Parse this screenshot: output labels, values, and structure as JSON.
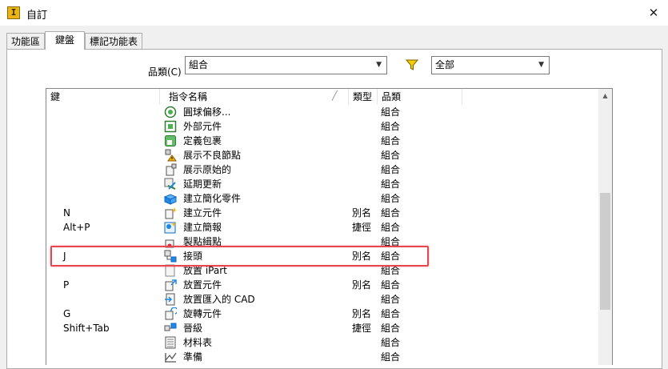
{
  "window": {
    "title": "自訂",
    "app_icon_letter": "I",
    "close_glyph": "✕"
  },
  "tabs": [
    {
      "label": "功能區",
      "active": false
    },
    {
      "label": "鍵盤",
      "active": true
    },
    {
      "label": "標記功能表",
      "active": false
    }
  ],
  "filter": {
    "category_label": "品類(C)",
    "category_value": "組合",
    "scope_value": "全部",
    "filter_icon": "funnel-icon",
    "filter_color": "#f2d000"
  },
  "table": {
    "headers": {
      "key": "鍵",
      "command": "指令名稱",
      "type": "類型",
      "category": "品類"
    },
    "rows": [
      {
        "key": "",
        "icon": "orbit-offset-icon",
        "name": "圓球偏移...",
        "type": "",
        "category": "組合"
      },
      {
        "key": "",
        "icon": "external-component-icon",
        "name": "外部元件",
        "type": "",
        "category": "組合"
      },
      {
        "key": "",
        "icon": "define-envelope-icon",
        "name": "定義包裹",
        "type": "",
        "category": "組合"
      },
      {
        "key": "",
        "icon": "show-sick-nodes-icon",
        "name": "展示不良節點",
        "type": "",
        "category": "組合"
      },
      {
        "key": "",
        "icon": "show-original-icon",
        "name": "展示原始的",
        "type": "",
        "category": "組合"
      },
      {
        "key": "",
        "icon": "defer-update-icon",
        "name": "延期更新",
        "type": "",
        "category": "組合"
      },
      {
        "key": "",
        "icon": "create-simplified-part-icon",
        "name": "建立簡化零件",
        "type": "",
        "category": "組合"
      },
      {
        "key": "N",
        "icon": "create-component-icon",
        "name": "建立元件",
        "type": "別名",
        "category": "組合"
      },
      {
        "key": "Alt+P",
        "icon": "create-profile-icon",
        "name": "建立簡報",
        "type": "捷徑",
        "category": "組合"
      },
      {
        "key": "",
        "icon": "make-points-icon",
        "name": "製點緝點",
        "type": "",
        "category": "組合"
      },
      {
        "key": "J",
        "icon": "joint-icon",
        "name": "接頭",
        "type": "別名",
        "category": "組合"
      },
      {
        "key": "",
        "icon": "place-ipart-icon",
        "name": "放置 iPart",
        "type": "",
        "category": "組合"
      },
      {
        "key": "P",
        "icon": "place-component-icon",
        "name": "放置元件",
        "type": "別名",
        "category": "組合"
      },
      {
        "key": "",
        "icon": "place-imported-cad-icon",
        "name": "放置匯入的 CAD",
        "type": "",
        "category": "組合"
      },
      {
        "key": "G",
        "icon": "rotate-component-icon",
        "name": "旋轉元件",
        "type": "別名",
        "category": "組合"
      },
      {
        "key": "Shift+Tab",
        "icon": "promote-icon",
        "name": "晉級",
        "type": "捷徑",
        "category": "組合"
      },
      {
        "key": "",
        "icon": "bill-of-materials-icon",
        "name": "材料表",
        "type": "",
        "category": "組合"
      },
      {
        "key": "",
        "icon": "prepare-icon",
        "name": "準備",
        "type": "",
        "category": "組合"
      }
    ]
  },
  "highlight_color": "#e8454f"
}
